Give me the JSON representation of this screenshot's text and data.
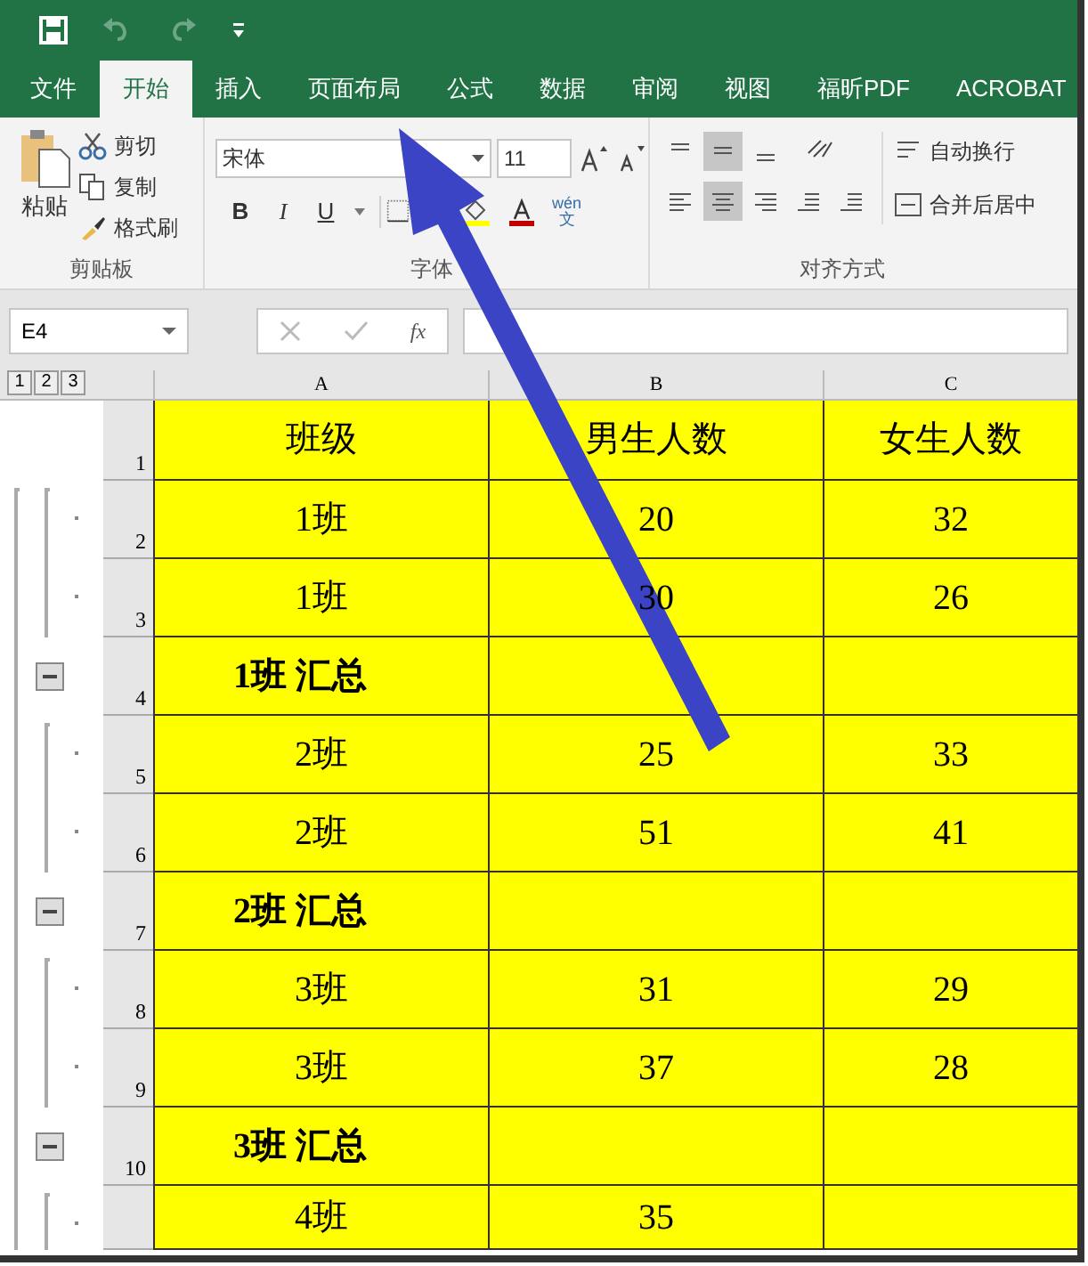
{
  "tabs": [
    {
      "label": "文件",
      "selected": false
    },
    {
      "label": "开始",
      "selected": true
    },
    {
      "label": "插入",
      "selected": false
    },
    {
      "label": "页面布局",
      "selected": false
    },
    {
      "label": "公式",
      "selected": false
    },
    {
      "label": "数据",
      "selected": false
    },
    {
      "label": "审阅",
      "selected": false
    },
    {
      "label": "视图",
      "selected": false
    },
    {
      "label": "福昕PDF",
      "selected": false
    },
    {
      "label": "ACROBAT",
      "selected": false
    }
  ],
  "ribbon": {
    "clipboard": {
      "paste": "粘贴",
      "cut": "剪切",
      "copy": "复制",
      "format_painter": "格式刷",
      "label": "剪贴板"
    },
    "font": {
      "font_name": "宋体",
      "font_size": "11",
      "bold": "B",
      "italic": "I",
      "underline": "U",
      "phonetic_top": "wén",
      "phonetic_bottom": "文",
      "label": "字体"
    },
    "alignment": {
      "wrap_text": "自动换行",
      "merge_center": "合并后居中",
      "label": "对齐方式"
    }
  },
  "formula_bar": {
    "name_box": "E4",
    "fx": "fx"
  },
  "outline_levels": [
    "1",
    "2",
    "3"
  ],
  "columns": [
    "A",
    "B",
    "C"
  ],
  "rows": [
    {
      "number": "1",
      "kind": "header",
      "cells": [
        "班级",
        "男生人数",
        "女生人数"
      ]
    },
    {
      "number": "2",
      "kind": "detail",
      "cells": [
        "1班",
        "20",
        "32"
      ]
    },
    {
      "number": "3",
      "kind": "detail",
      "cells": [
        "1班",
        "30",
        "26"
      ]
    },
    {
      "number": "4",
      "kind": "subtotal",
      "cells": [
        "1班 汇总"
      ]
    },
    {
      "number": "5",
      "kind": "detail",
      "cells": [
        "2班",
        "25",
        "33"
      ]
    },
    {
      "number": "6",
      "kind": "detail",
      "cells": [
        "2班",
        "51",
        "41"
      ]
    },
    {
      "number": "7",
      "kind": "subtotal",
      "cells": [
        "2班 汇总"
      ]
    },
    {
      "number": "8",
      "kind": "detail",
      "cells": [
        "3班",
        "31",
        "29"
      ]
    },
    {
      "number": "9",
      "kind": "detail",
      "cells": [
        "3班",
        "37",
        "28"
      ]
    },
    {
      "number": "10",
      "kind": "subtotal",
      "cells": [
        "3班 汇总"
      ]
    },
    {
      "kind": "detail",
      "cells": [
        "4班",
        "35"
      ]
    }
  ]
}
